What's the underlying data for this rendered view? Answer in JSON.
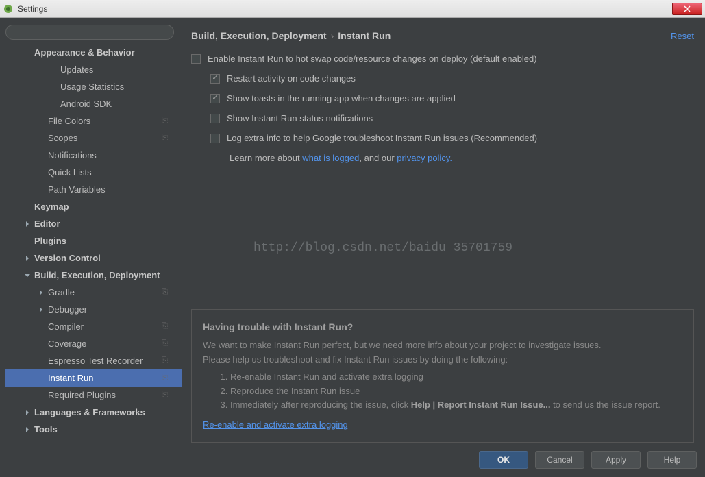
{
  "window": {
    "title": "Settings"
  },
  "search": {
    "placeholder": ""
  },
  "tree": {
    "items": [
      {
        "label": "Appearance & Behavior",
        "bold": true,
        "indent": 1
      },
      {
        "label": "Updates",
        "indent": 3
      },
      {
        "label": "Usage Statistics",
        "indent": 3
      },
      {
        "label": "Android SDK",
        "indent": 3
      },
      {
        "label": "File Colors",
        "indent": 2,
        "badge": "⎘"
      },
      {
        "label": "Scopes",
        "indent": 2,
        "badge": "⎘"
      },
      {
        "label": "Notifications",
        "indent": 2
      },
      {
        "label": "Quick Lists",
        "indent": 2
      },
      {
        "label": "Path Variables",
        "indent": 2
      },
      {
        "label": "Keymap",
        "bold": true,
        "indent": 1
      },
      {
        "label": "Editor",
        "bold": true,
        "indent": 1,
        "arrow": "right"
      },
      {
        "label": "Plugins",
        "bold": true,
        "indent": 1
      },
      {
        "label": "Version Control",
        "bold": true,
        "indent": 1,
        "arrow": "right"
      },
      {
        "label": "Build, Execution, Deployment",
        "bold": true,
        "indent": 1,
        "arrow": "down"
      },
      {
        "label": "Gradle",
        "indent": 2,
        "arrow": "right",
        "badge": "⎘"
      },
      {
        "label": "Debugger",
        "indent": 2,
        "arrow": "right"
      },
      {
        "label": "Compiler",
        "indent": 2,
        "badge": "⎘"
      },
      {
        "label": "Coverage",
        "indent": 2,
        "badge": "⎘"
      },
      {
        "label": "Espresso Test Recorder",
        "indent": 2,
        "badge": "⎘"
      },
      {
        "label": "Instant Run",
        "indent": 2,
        "selected": true,
        "badge": "⎘"
      },
      {
        "label": "Required Plugins",
        "indent": 2,
        "badge": "⎘"
      },
      {
        "label": "Languages & Frameworks",
        "bold": true,
        "indent": 1,
        "arrow": "right"
      },
      {
        "label": "Tools",
        "bold": true,
        "indent": 1,
        "arrow": "right"
      }
    ]
  },
  "breadcrumb": {
    "part1": "Build, Execution, Deployment",
    "part2": "Instant Run"
  },
  "reset": "Reset",
  "options": {
    "enable": "Enable Instant Run to hot swap code/resource changes on deploy (default enabled)",
    "restart": "Restart activity on code changes",
    "toasts": "Show toasts in the running app when changes are applied",
    "status": "Show Instant Run status notifications",
    "logextra": "Log extra info to help Google troubleshoot Instant Run issues (Recommended)",
    "learn_prefix": "Learn more about ",
    "learn_link1": "what is logged",
    "learn_mid": ", and our ",
    "learn_link2": "privacy policy."
  },
  "watermark": "http://blog.csdn.net/baidu_35701759",
  "trouble": {
    "heading": "Having trouble with Instant Run?",
    "p1": "We want to make Instant Run perfect, but we need more info about your project to investigate issues.",
    "p2": "Please help us troubleshoot and fix Instant Run issues by doing the following:",
    "li1": "Re-enable Instant Run and activate extra logging",
    "li2": "Reproduce the Instant Run issue",
    "li3a": "Immediately after reproducing the issue, click ",
    "li3b": "Help | Report Instant Run Issue...",
    "li3c": " to send us the issue report.",
    "link": "Re-enable and activate extra logging"
  },
  "buttons": {
    "ok": "OK",
    "cancel": "Cancel",
    "apply": "Apply",
    "help": "Help"
  }
}
